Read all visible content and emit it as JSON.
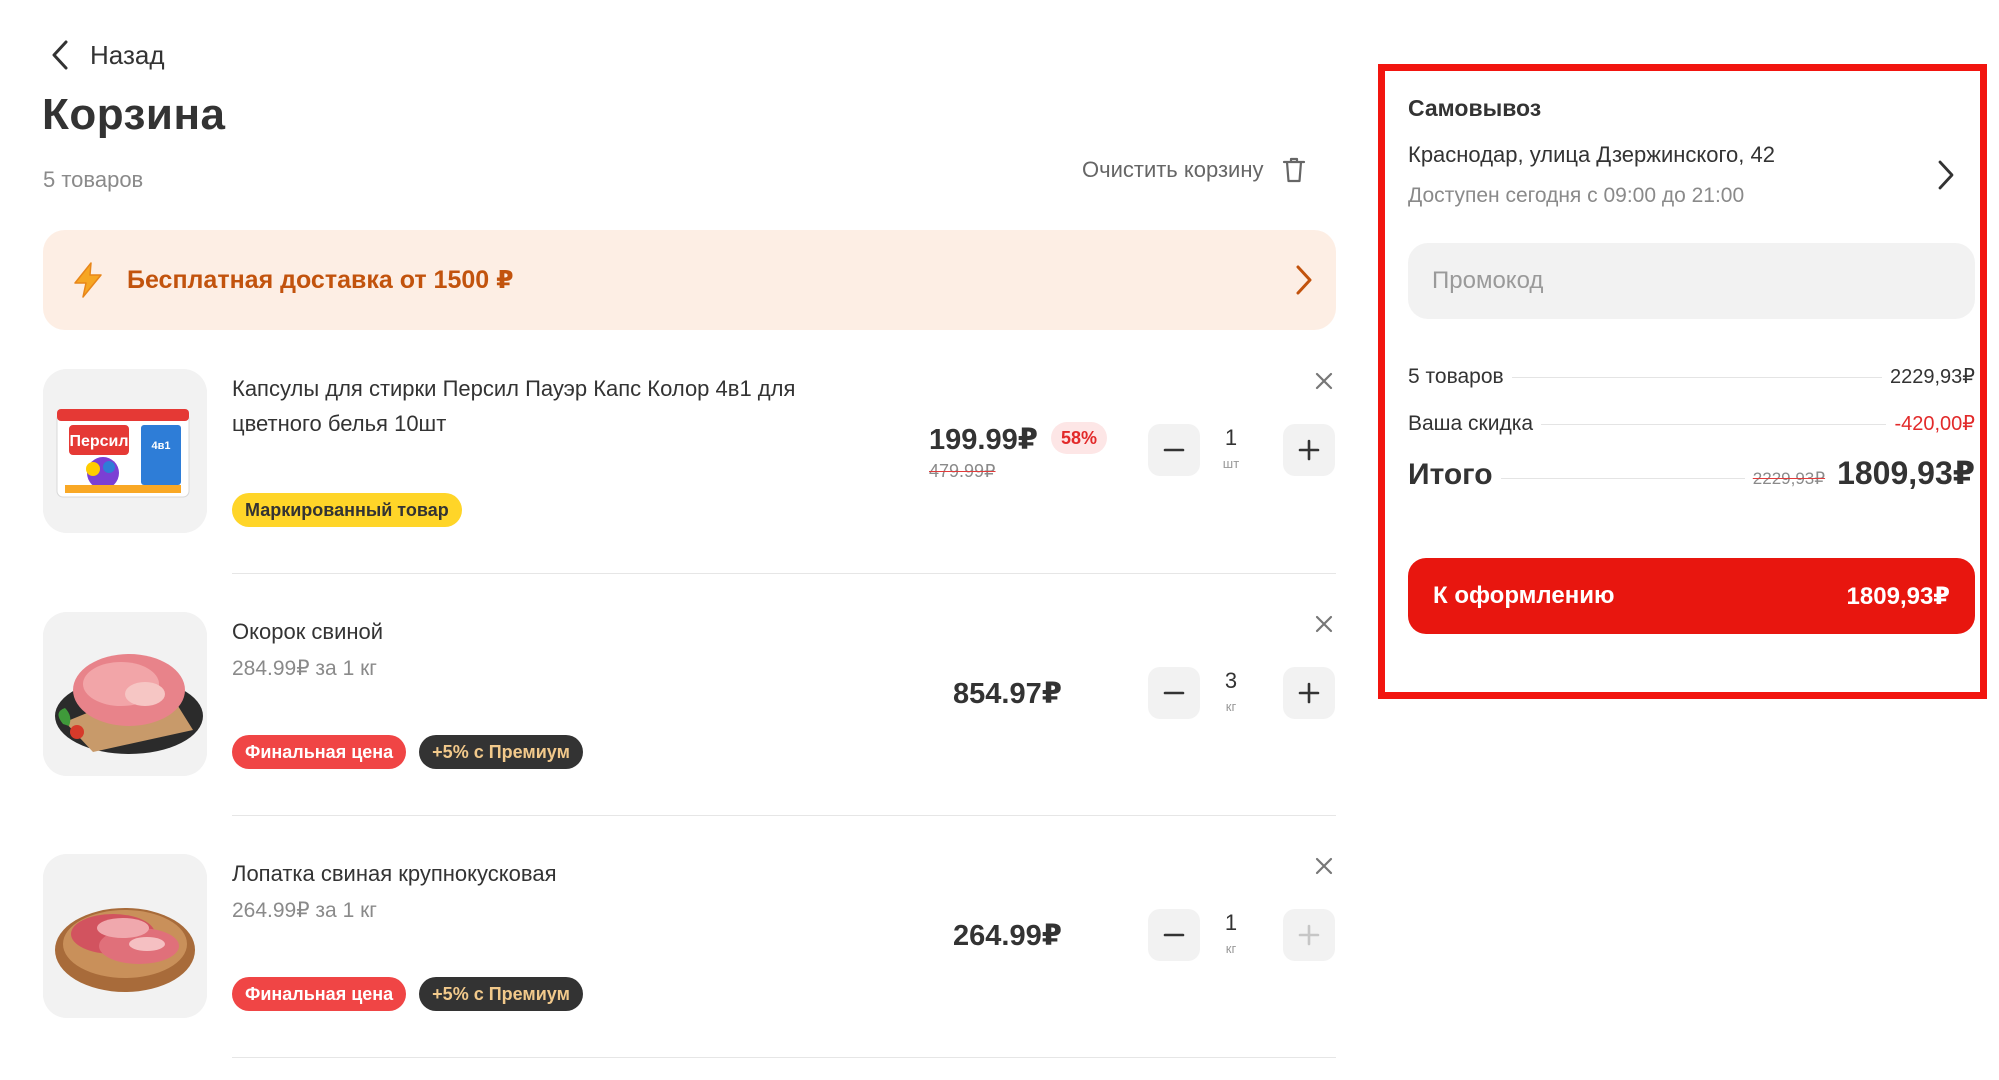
{
  "header": {
    "back_label": "Назад",
    "title": "Корзина",
    "items_count": "5 товаров",
    "clear_label": "Очистить корзину"
  },
  "banner": {
    "label": "Бесплатная доставка от 1500 ₽"
  },
  "items": [
    {
      "name": "Капсулы для стирки Персил Пауэр Капс Колор 4в1 для цветного белья 10шт",
      "price": "199.99₽",
      "old_price": "479.99₽",
      "discount": "58%",
      "quantity": "1",
      "unit": "шт",
      "tags": [
        "Маркированный товар"
      ],
      "image": "persil-capsules-box",
      "thumb_label": "Персил",
      "thumb_badge": "4в1"
    },
    {
      "name": "Окорок свиной",
      "unit_price": "284.99₽ за 1 кг",
      "price": "854.97₽",
      "quantity": "3",
      "unit": "кг",
      "tags": [
        "Финальная цена",
        "+5% с Премиум"
      ],
      "image": "pork-ham-on-board"
    },
    {
      "name": "Лопатка свиная крупнокусковая",
      "unit_price": "264.99₽ за 1 кг",
      "price": "264.99₽",
      "quantity": "1",
      "unit": "кг",
      "tags": [
        "Финальная цена",
        "+5% с Премиум"
      ],
      "image": "pork-shoulder-on-plate"
    }
  ],
  "summary": {
    "delivery_type": "Самовывоз",
    "address": "Краснодар, улица Дзержинского, 42",
    "hours": "Доступен сегодня с 09:00 до 21:00",
    "promo_placeholder": "Промокод",
    "promo_value": "",
    "goods_label": "5 товаров",
    "goods_value": "2229,93₽",
    "discount_label": "Ваша скидка",
    "discount_value": "-420,00₽",
    "total_label": "Итого",
    "total_old": "2229,93₽",
    "total_value": "1809,93₽",
    "checkout_label": "К оформлению",
    "checkout_total": "1809,93₽"
  },
  "colors": {
    "accent": "#e8160f",
    "banner_bg": "#fdeee4",
    "banner_text": "#c2530d",
    "discount_red": "#e22a2a",
    "tag_yellow": "#ffd528",
    "tag_red": "#f04545",
    "tag_dark": "#333333"
  },
  "icons": {
    "back": "chevron-left-icon",
    "clear": "trash-icon",
    "banner": "lightning-icon",
    "banner_arrow": "chevron-right-icon",
    "remove": "close-icon",
    "decrease": "minus-icon",
    "increase": "plus-icon",
    "address_arrow": "chevron-right-icon"
  }
}
